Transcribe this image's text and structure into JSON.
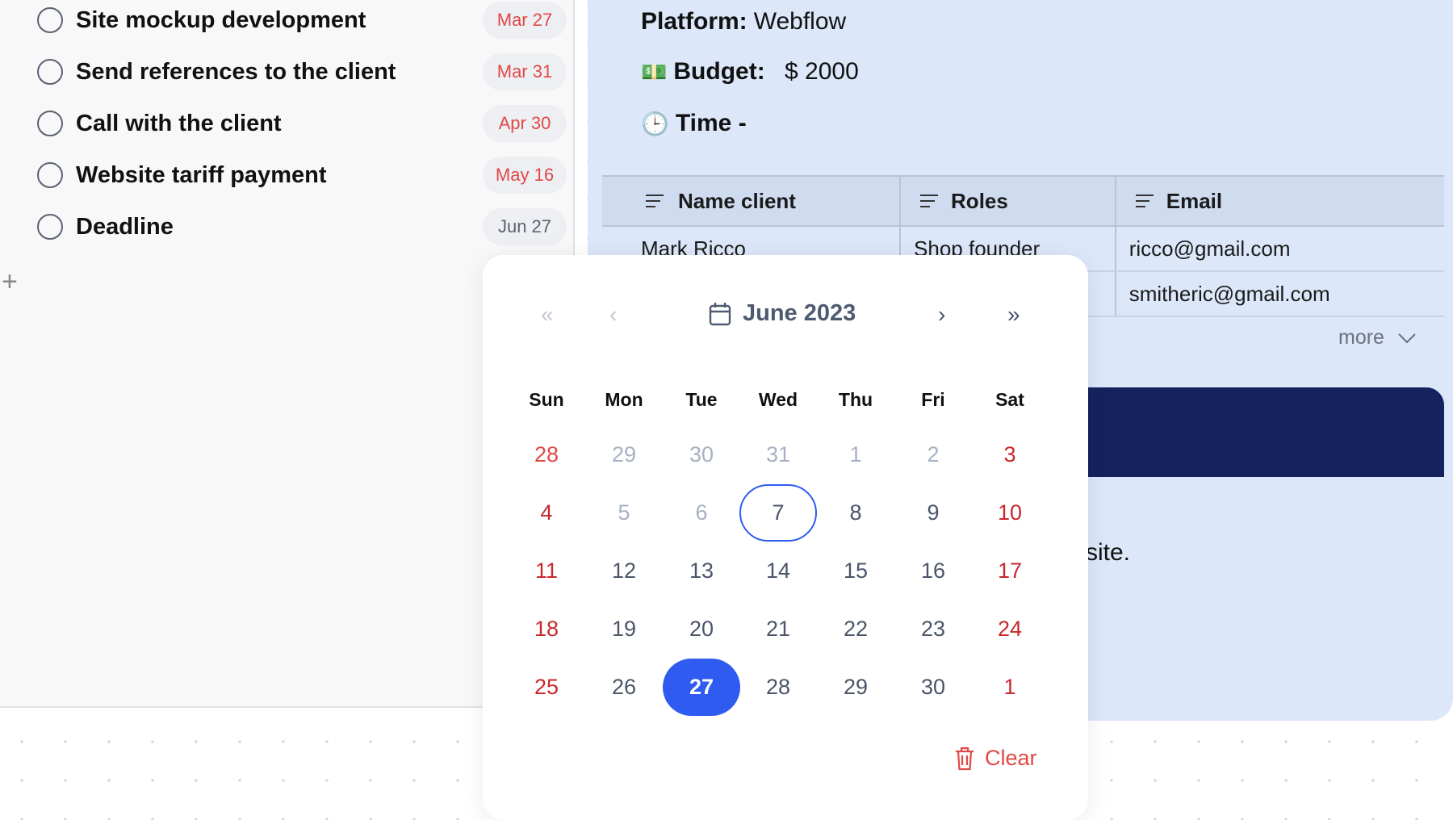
{
  "tasks": [
    {
      "label": "Site mockup development",
      "date": "Mar 27",
      "overdue": true
    },
    {
      "label": "Send references to the client",
      "date": "Mar 31",
      "overdue": true
    },
    {
      "label": "Call with the client",
      "date": "Apr 30",
      "overdue": true
    },
    {
      "label": "Website tariff payment",
      "date": "May 16",
      "overdue": true
    },
    {
      "label": "Deadline",
      "date": "Jun 27",
      "overdue": false
    }
  ],
  "add_icon": "plus-icon",
  "details": {
    "platform_label": "Platform:",
    "platform_value": "Webflow",
    "budget_label": "Budget:",
    "budget_value": "$ 2000",
    "time_label": "Time -"
  },
  "table": {
    "headers": [
      "Name client",
      "Roles",
      "Email"
    ],
    "rows": [
      [
        "Mark Ricco",
        "Shop founder",
        "ricco@gmail.com"
      ],
      [
        "",
        "",
        "smitheric@gmail.com"
      ]
    ]
  },
  "more_label": "more",
  "partial_text": "site.",
  "calendar": {
    "month_label": "June 2023",
    "prev_year": "«",
    "prev_month": "‹",
    "next_month": "›",
    "next_year": "»",
    "weekdays": [
      "Sun",
      "Mon",
      "Tue",
      "Wed",
      "Thu",
      "Fri",
      "Sat"
    ],
    "weeks": [
      [
        {
          "d": "28",
          "t": "weekend-other"
        },
        {
          "d": "29",
          "t": "other"
        },
        {
          "d": "30",
          "t": "other"
        },
        {
          "d": "31",
          "t": "other"
        },
        {
          "d": "1",
          "t": "disabled"
        },
        {
          "d": "2",
          "t": "disabled"
        },
        {
          "d": "3",
          "t": "weekend"
        }
      ],
      [
        {
          "d": "4",
          "t": "weekend"
        },
        {
          "d": "5",
          "t": "disabled"
        },
        {
          "d": "6",
          "t": "disabled"
        },
        {
          "d": "7",
          "t": "today"
        },
        {
          "d": "8",
          "t": "normal"
        },
        {
          "d": "9",
          "t": "normal"
        },
        {
          "d": "10",
          "t": "weekend"
        }
      ],
      [
        {
          "d": "11",
          "t": "weekend"
        },
        {
          "d": "12",
          "t": "normal"
        },
        {
          "d": "13",
          "t": "normal"
        },
        {
          "d": "14",
          "t": "normal"
        },
        {
          "d": "15",
          "t": "normal"
        },
        {
          "d": "16",
          "t": "normal"
        },
        {
          "d": "17",
          "t": "weekend"
        }
      ],
      [
        {
          "d": "18",
          "t": "weekend"
        },
        {
          "d": "19",
          "t": "normal"
        },
        {
          "d": "20",
          "t": "normal"
        },
        {
          "d": "21",
          "t": "normal"
        },
        {
          "d": "22",
          "t": "normal"
        },
        {
          "d": "23",
          "t": "normal"
        },
        {
          "d": "24",
          "t": "weekend"
        }
      ],
      [
        {
          "d": "25",
          "t": "weekend"
        },
        {
          "d": "26",
          "t": "normal"
        },
        {
          "d": "27",
          "t": "selected"
        },
        {
          "d": "28",
          "t": "normal"
        },
        {
          "d": "29",
          "t": "normal"
        },
        {
          "d": "30",
          "t": "normal"
        },
        {
          "d": "1",
          "t": "weekend"
        }
      ]
    ],
    "selected": "27",
    "today": "7",
    "clear_label": "Clear"
  },
  "colors": {
    "accent": "#2f5bf0",
    "weekend": "#c8282e",
    "overdue": "#e04848",
    "navy": "#14235e",
    "panel": "#dce7f9"
  }
}
